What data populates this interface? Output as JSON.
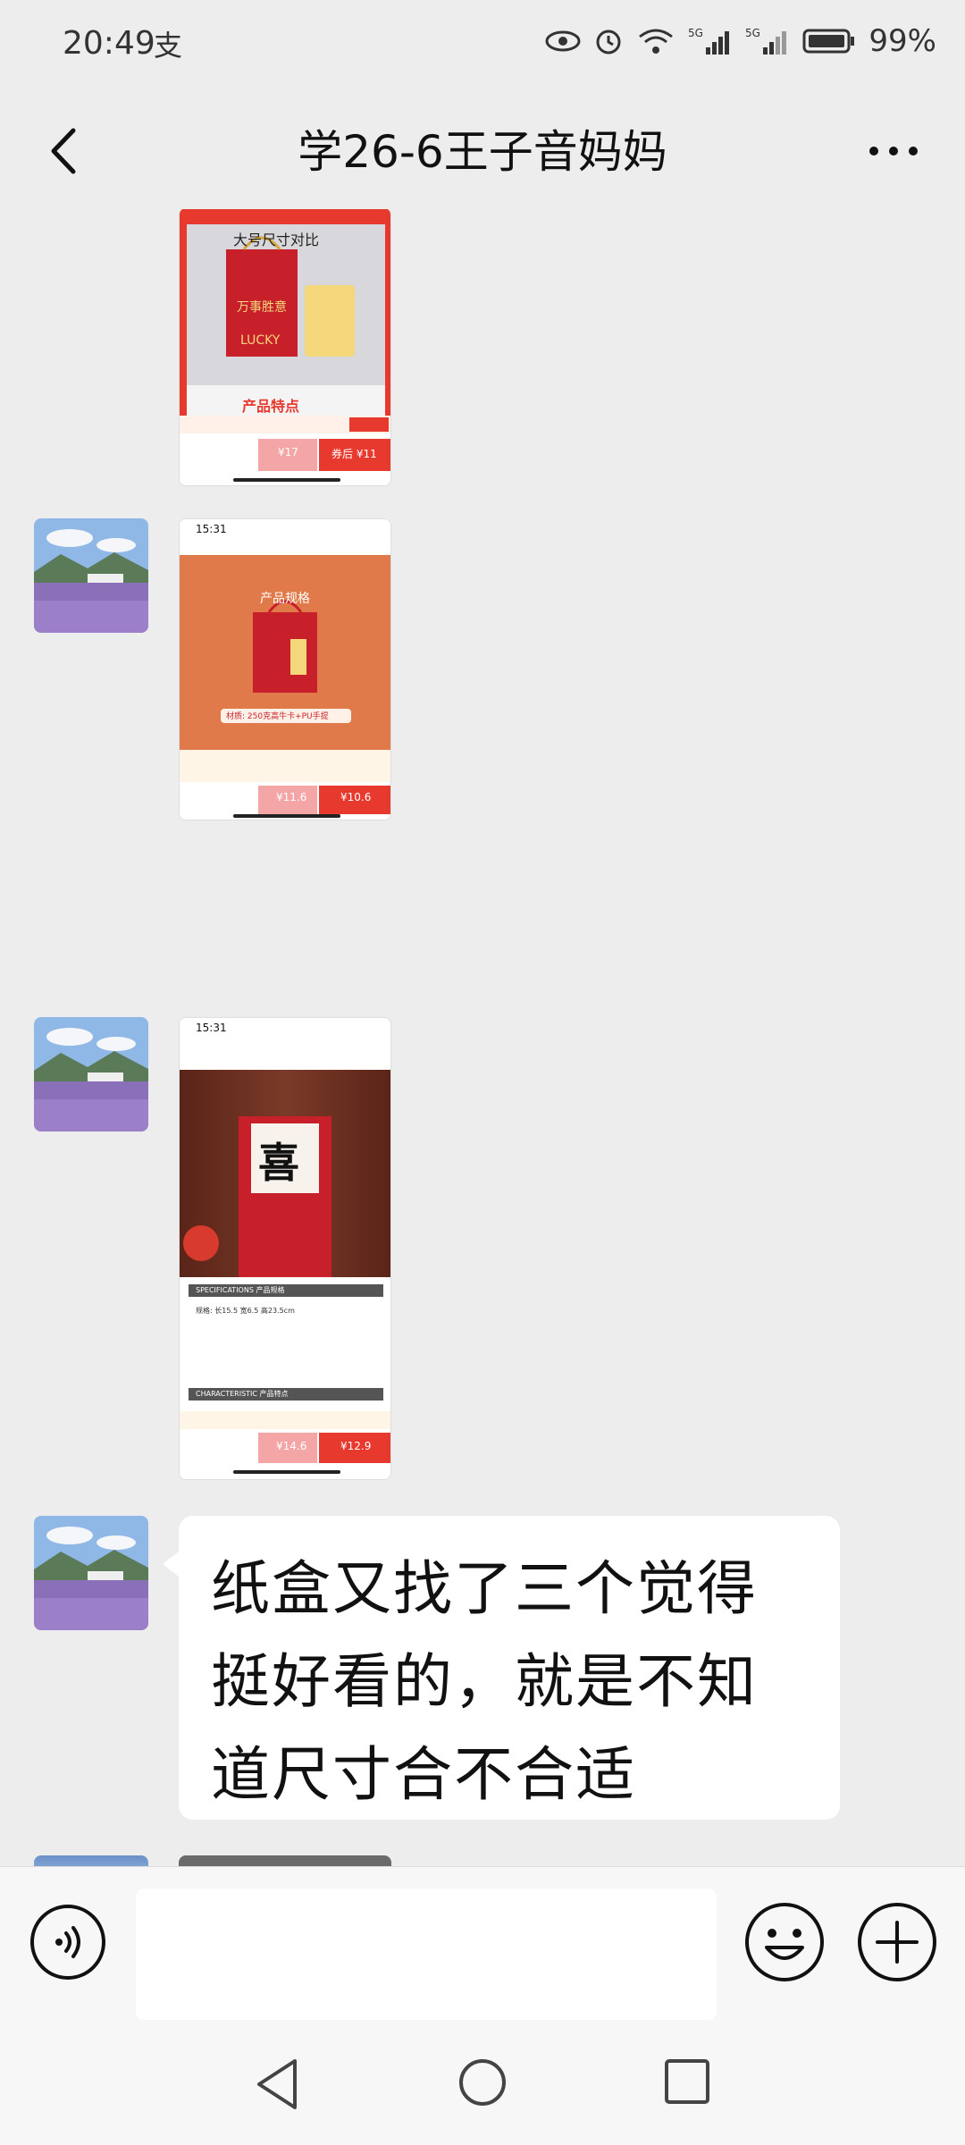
{
  "status_bar": {
    "time": "20:49",
    "battery": "99%",
    "icons": [
      "alipay-icon",
      "eye-icon",
      "alarm-icon",
      "wifi-icon",
      "signal-5g-icon",
      "signal-5g-icon",
      "battery-icon"
    ]
  },
  "header": {
    "title": "学26-6王子音妈妈"
  },
  "messages": [
    {
      "type": "image",
      "overlay": {
        "heading": "大号尺寸对比",
        "line1": "万事胜意",
        "line2": "LUCKY",
        "feature": "产品特点",
        "price_left": "¥17",
        "price_right": "券后 ¥11"
      }
    },
    {
      "type": "image",
      "overlay": {
        "time": "15:31",
        "heading": "产品规格",
        "material": "材质: 250克高牛卡+PU手提",
        "price_left": "¥11.6",
        "price_right": "¥10.6"
      }
    },
    {
      "type": "image",
      "overlay": {
        "time": "15:31",
        "char": "喜",
        "spec_title": "SPECIFICATIONS 产品规格",
        "spec_line": "规格: 长15.5 宽6.5 高23.5cm",
        "char_title": "CHARACTERISTIC 产品特点",
        "price_left": "¥14.6",
        "price_right": "¥12.9"
      }
    },
    {
      "type": "text",
      "text": "纸盒又找了三个觉得挺好看的，就是不知道尺寸合不合适"
    }
  ],
  "colors": {
    "background": "#ededed",
    "bubble": "#ffffff",
    "input_bar": "#f7f7f7"
  }
}
